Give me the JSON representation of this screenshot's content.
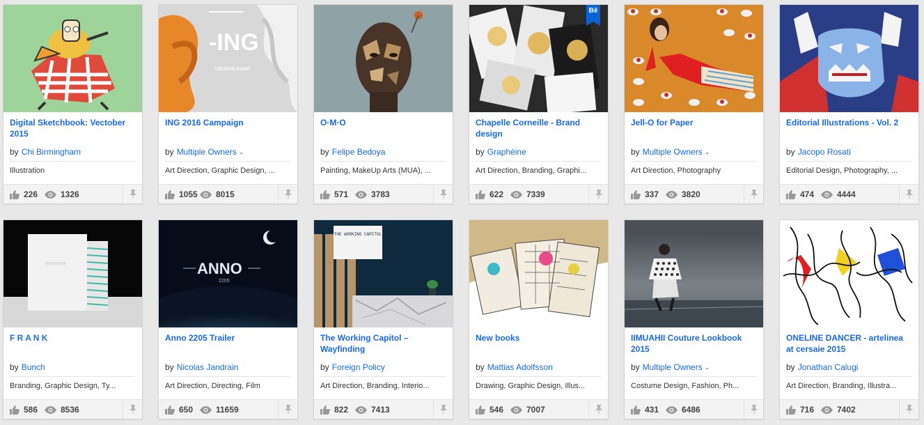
{
  "projects": [
    {
      "title": "Digital Sketchbook: Vectober 2015",
      "by_label": "by",
      "owner": "Chi Birmingham",
      "multiple": false,
      "fields": "Illustration",
      "appreciations": "226",
      "views": "1326",
      "cover": "cartoon-cover"
    },
    {
      "title": "ING 2016 Campaign",
      "by_label": "by",
      "owner": "Multiple Owners",
      "multiple": true,
      "fields": "Art Direction, Graphic Design, ...",
      "appreciations": "1055",
      "views": "8015",
      "cover": "fabric-cover",
      "cover_text": "-ING",
      "cover_sub": "CREATIVE EVENT"
    },
    {
      "title": "O·M·O",
      "by_label": "by",
      "owner": "Felipe Bedoya",
      "multiple": false,
      "fields": "Painting, MakeUp Arts (MUA), ...",
      "appreciations": "571",
      "views": "3783",
      "cover": "portrait-cover"
    },
    {
      "title": "Chapelle Corneille - Brand design",
      "by_label": "by",
      "owner": "Graphéine",
      "multiple": false,
      "fields": "Art Direction, Branding, Graphi...",
      "appreciations": "622",
      "views": "7339",
      "cover": "posters-cover",
      "badge": "Bē"
    },
    {
      "title": "Jell-O for Paper",
      "by_label": "by",
      "owner": "Multiple Owners",
      "multiple": true,
      "fields": "Art Direction, Photography",
      "appreciations": "337",
      "views": "3820",
      "cover": "jello-cover"
    },
    {
      "title": "Editorial Illustrations - Vol. 2",
      "by_label": "by",
      "owner": "Jacopo Rosati",
      "multiple": false,
      "fields": "Editorial Design, Photography, ...",
      "appreciations": "474",
      "views": "4444",
      "cover": "felt-cover"
    },
    {
      "title": "F R A N K",
      "by_label": "by",
      "owner": "Bunch",
      "multiple": false,
      "fields": "Branding, Graphic Design, Ty...",
      "appreciations": "586",
      "views": "8536",
      "cover": "book-cover"
    },
    {
      "title": "Anno 2205 Trailer",
      "by_label": "by",
      "owner": "Nicolas Jandrain",
      "multiple": false,
      "fields": "Art Direction, Directing, Film",
      "appreciations": "650",
      "views": "11659",
      "cover": "space-cover",
      "cover_text": "ANNO",
      "cover_sub": "2205"
    },
    {
      "title": "The Working Capitol – Wayfinding",
      "by_label": "by",
      "owner": "Foreign Policy",
      "multiple": false,
      "fields": "Art Direction, Branding, Interio...",
      "appreciations": "822",
      "views": "7413",
      "cover": "interior-cover",
      "cover_text": "THE WORKING CAPITOL"
    },
    {
      "title": "New books",
      "by_label": "by",
      "owner": "Mattias Adolfsson",
      "multiple": false,
      "fields": "Drawing, Graphic Design, Illus...",
      "appreciations": "546",
      "views": "7007",
      "cover": "books-cover"
    },
    {
      "title": "IIMUAHII Couture Lookbook 2015",
      "by_label": "by",
      "owner": "Multiple Owners",
      "multiple": true,
      "fields": "Costume Design, Fashion, Ph...",
      "appreciations": "431",
      "views": "6486",
      "cover": "fashion-cover"
    },
    {
      "title": "ONELINE DANCER - artelinea at cersaie 2015",
      "by_label": "by",
      "owner": "Jonathan Calugi",
      "multiple": false,
      "fields": "Art Direction, Branding, Illustra...",
      "appreciations": "716",
      "views": "7402",
      "cover": "lines-cover"
    }
  ],
  "icons": {
    "appreciate": "thumbs-up-icon",
    "views": "eye-icon",
    "save": "pin-icon",
    "multiple": "chevron-down-icon"
  },
  "colors": {
    "link": "#1769ff",
    "stats_bg": "#f3f3f3",
    "page_bg": "#e8e8e8"
  }
}
